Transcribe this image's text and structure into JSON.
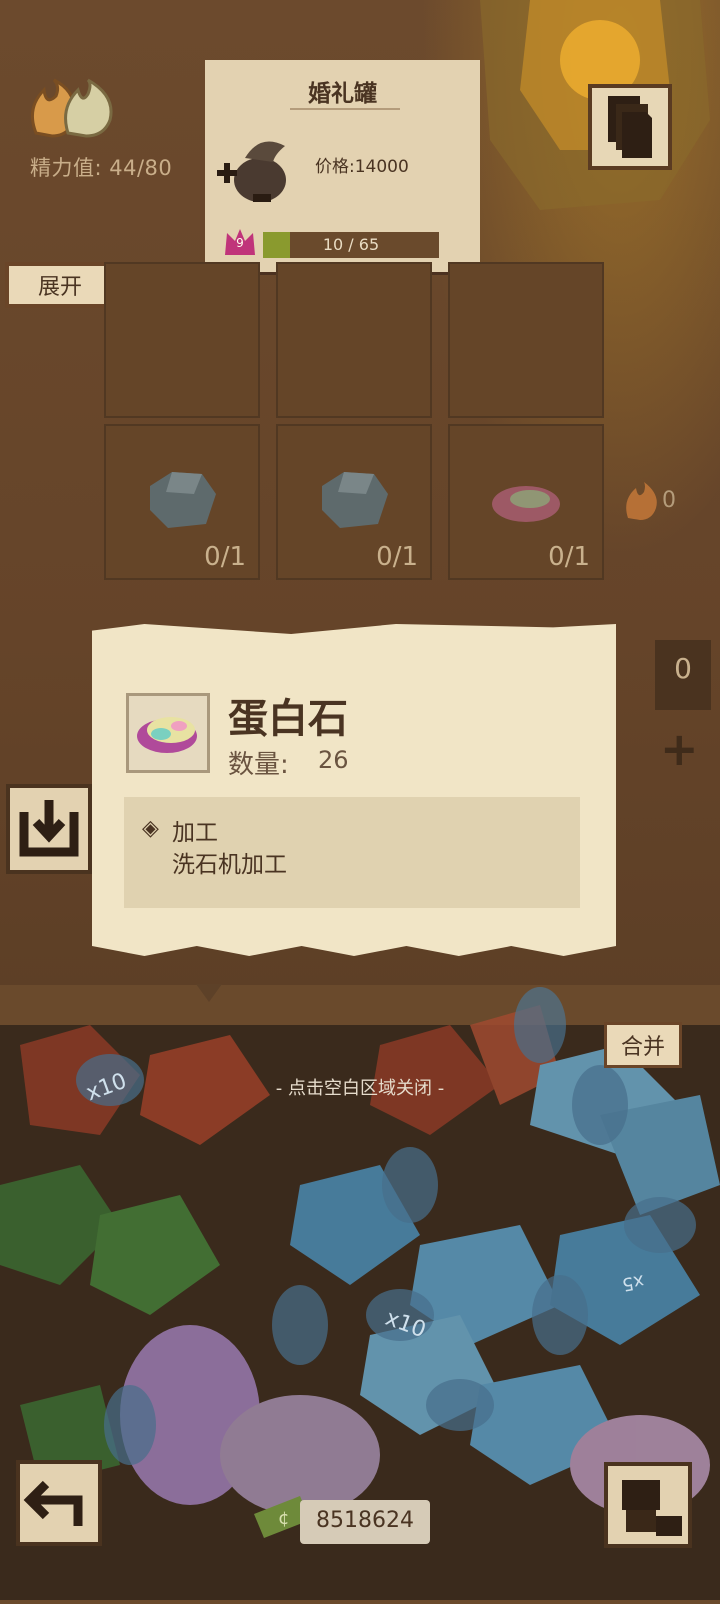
{
  "energy": {
    "label": "精力值: 44/80",
    "icon": "flame-icon"
  },
  "expand_button": "展开",
  "product": {
    "title": "婚礼罐",
    "price": "价格:14000",
    "level": "9",
    "progress_text": "10 / 65",
    "progress_fraction": 0.154
  },
  "grid": {
    "cells": [
      {
        "count": ""
      },
      {
        "count": ""
      },
      {
        "count": ""
      },
      {
        "count": "0/1",
        "icon": "stone-icon"
      },
      {
        "count": "0/1",
        "icon": "stone-icon"
      },
      {
        "count": "0/1",
        "icon": "opal-icon"
      }
    ]
  },
  "right_side": {
    "energy_count": "0",
    "panel_count": "0",
    "plus_icon": "plus-icon"
  },
  "popup": {
    "item_name": "蛋白石",
    "qty_label": "数量:",
    "qty_value": "26",
    "section_title": "加工",
    "section_desc": "洗石机加工"
  },
  "bottom": {
    "close_hint": "- 点击空白区域关闭 -",
    "merge_button": "合并",
    "money": "8518624",
    "gem_labels": [
      "x10",
      "x5"
    ]
  },
  "colors": {
    "popup_bg": "#f1e5c6",
    "wood": "#6b4a2c",
    "text_dark": "#4a3422"
  }
}
